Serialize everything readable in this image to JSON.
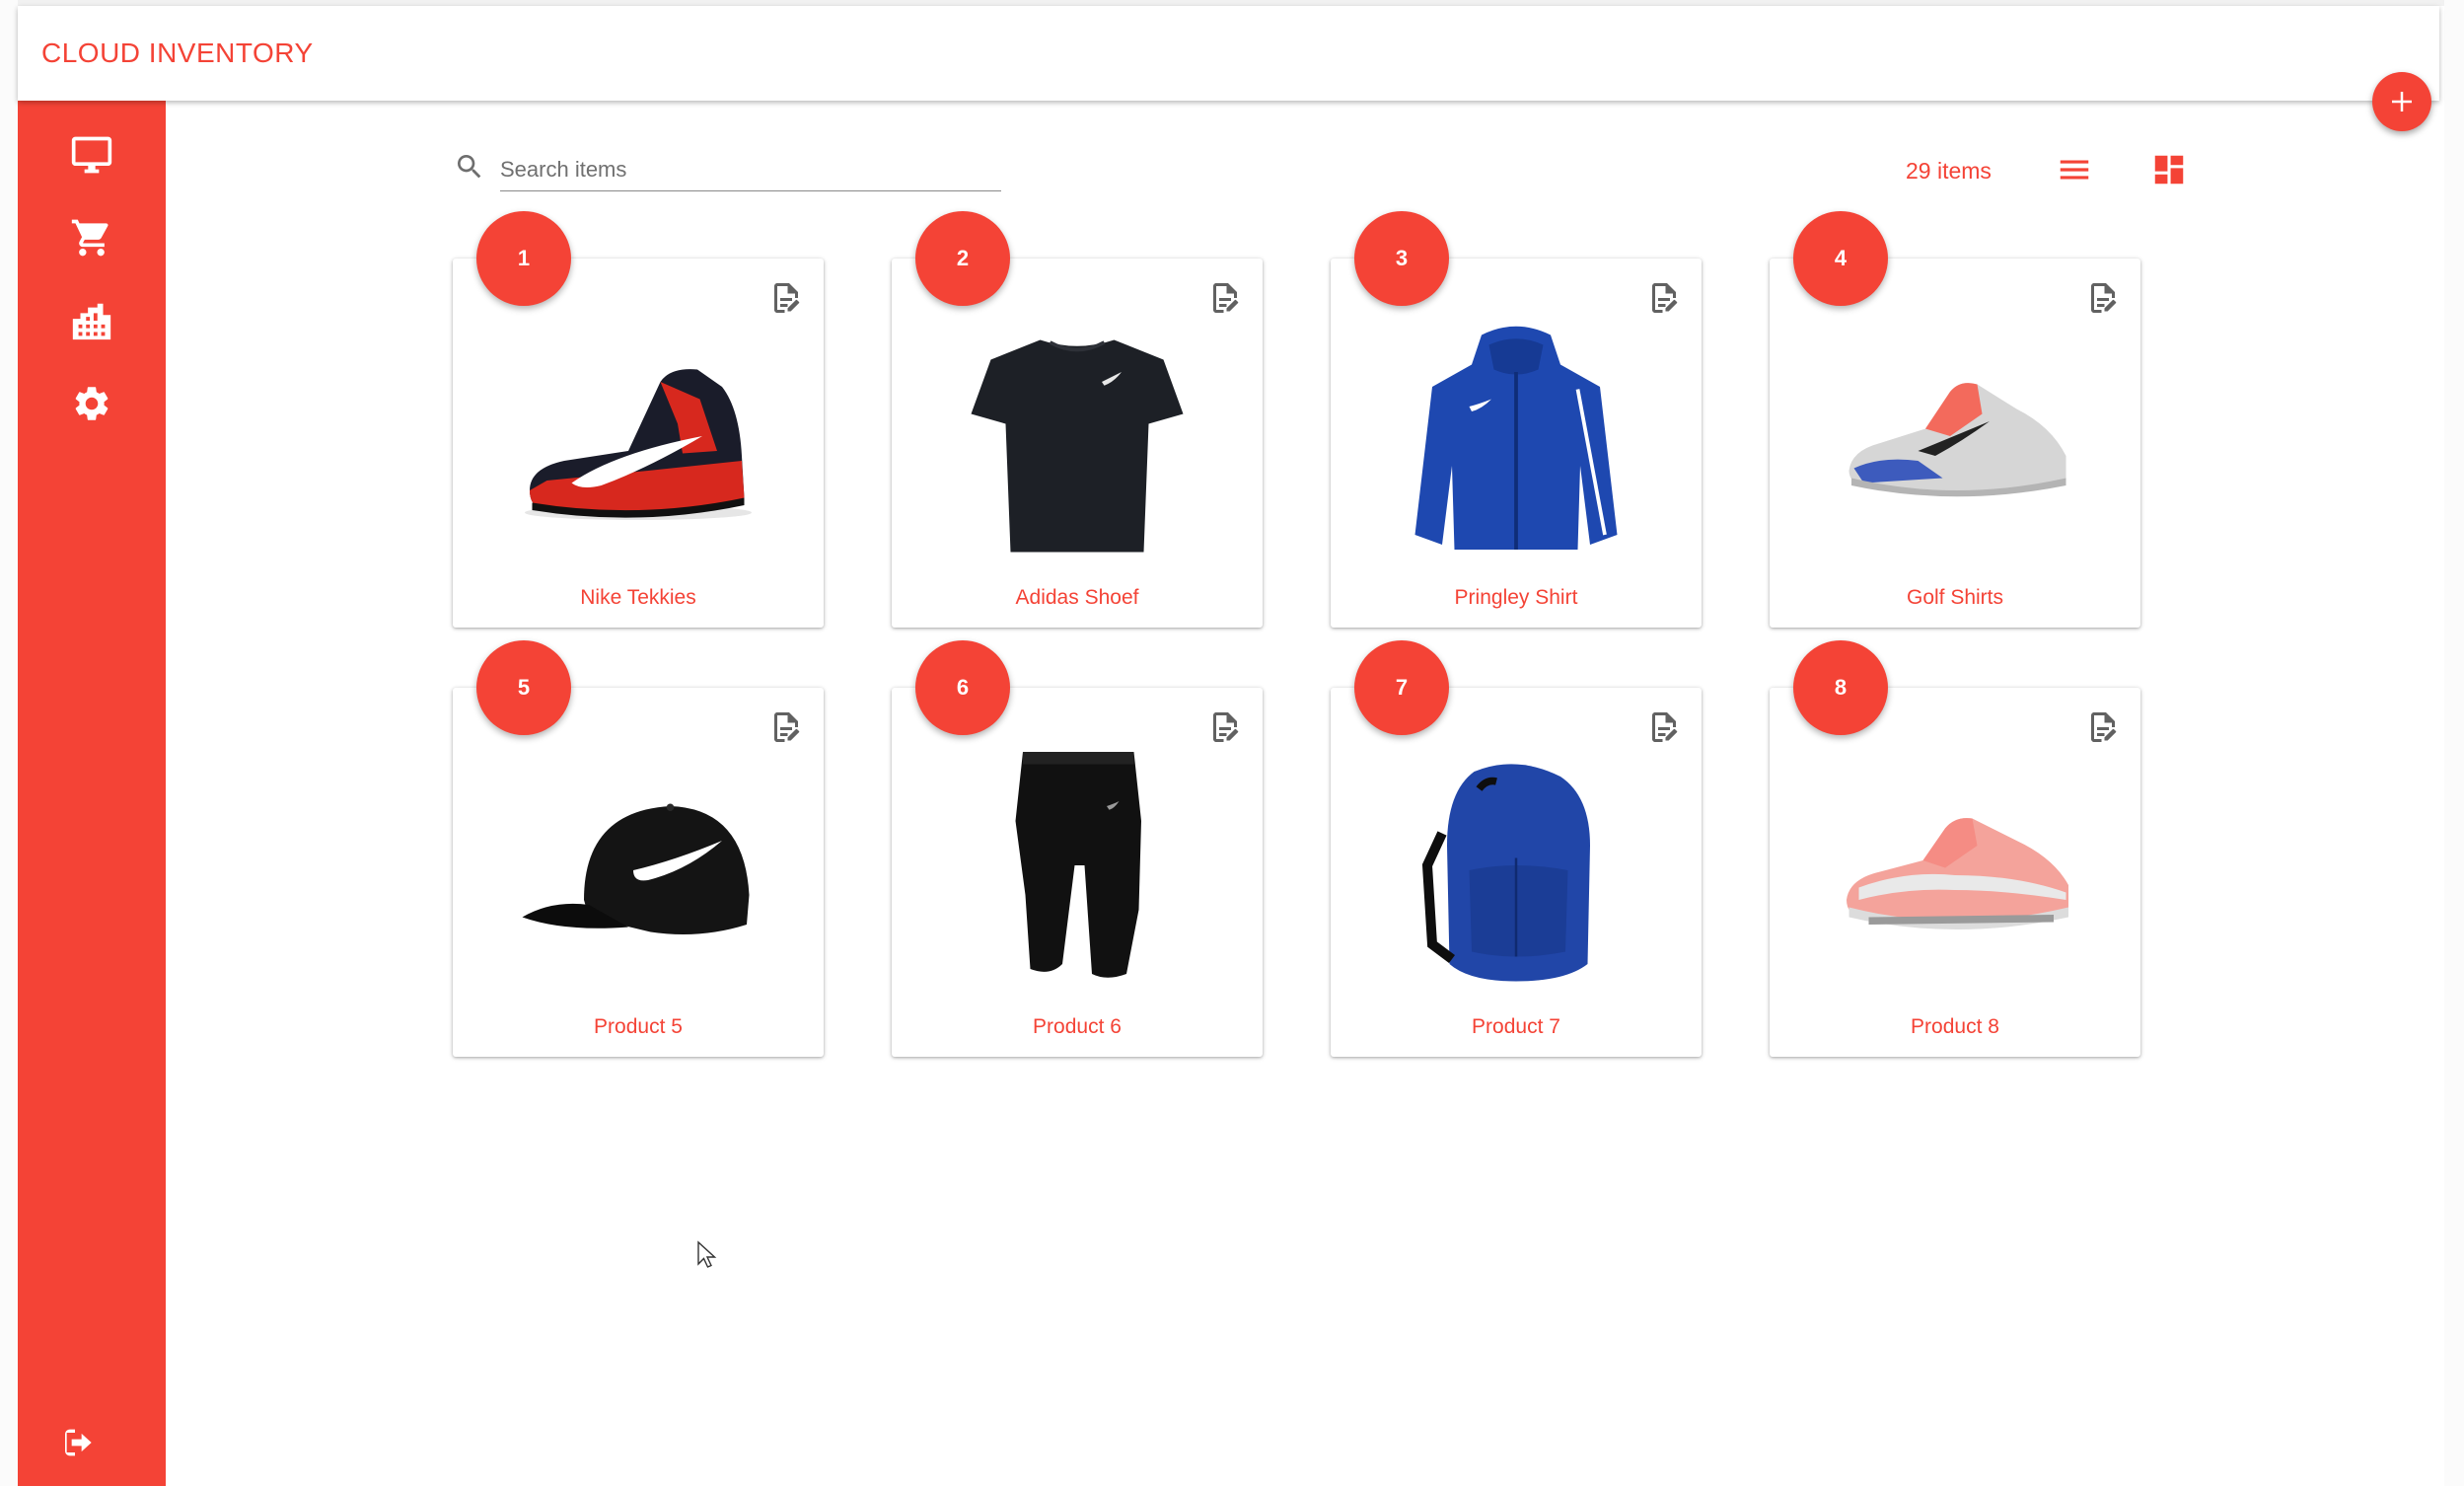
{
  "app": {
    "brand_first": "CLOUD",
    "brand_second": "INVENTORY"
  },
  "theme": {
    "accent": "#f44336"
  },
  "sidebar": {
    "items": [
      {
        "icon": "monitor-icon"
      },
      {
        "icon": "cart-icon"
      },
      {
        "icon": "warehouse-icon"
      },
      {
        "icon": "gear-icon"
      }
    ],
    "logout_icon": "logout-icon"
  },
  "search": {
    "placeholder": "Search items",
    "value": ""
  },
  "toolbar": {
    "count_label": "29 items",
    "list_icon": "list-view-icon",
    "grid_icon": "grid-view-icon"
  },
  "products": [
    {
      "number": "1",
      "name": "Nike Tekkies",
      "image": "sneaker-image"
    },
    {
      "number": "2",
      "name": "Adidas Shoef",
      "image": "tshirt-image"
    },
    {
      "number": "3",
      "name": "Pringley Shirt",
      "image": "jacket-image"
    },
    {
      "number": "4",
      "name": "Golf Shirts",
      "image": "sneaker-image"
    },
    {
      "number": "5",
      "name": "Product 5",
      "image": "cap-image"
    },
    {
      "number": "6",
      "name": "Product 6",
      "image": "pants-image"
    },
    {
      "number": "7",
      "name": "Product 7",
      "image": "backpack-image"
    },
    {
      "number": "8",
      "name": "Product 8",
      "image": "sneaker-image"
    }
  ]
}
